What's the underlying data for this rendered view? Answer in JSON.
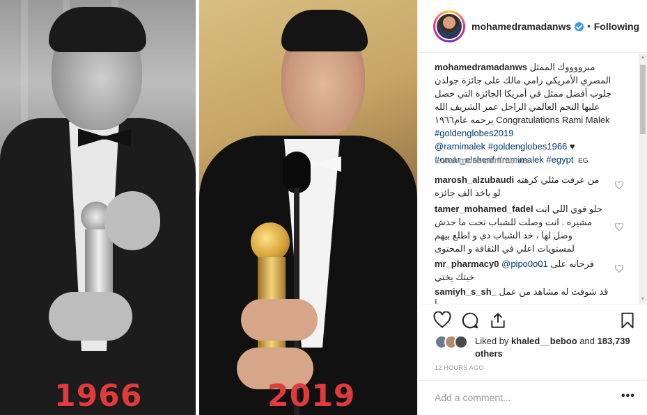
{
  "post_image": {
    "left_year": "1966",
    "right_year": "2019"
  },
  "header": {
    "username": "mohamedramadanws",
    "separator": "•",
    "follow_status": "Following"
  },
  "caption": {
    "username": "mohamedramadanws",
    "text_ar": "مبرووووك الممثل المصري الأمريكي رامي مالك على جائزة جولدن جلوب أفضل ممثل في أمريكا الجائزة التي حصل عليها النجم العالمي الراحل عمر الشريف الله يرحمه عام١٩٦٦",
    "text_en": "Congratulations Rami Malek",
    "tags_line1": "#goldenglobes2019",
    "mention": "@ramimalek",
    "tag_1966": "#goldenglobes1966",
    "heart": "♥",
    "tags_line3": "#omar_elsherif #ramimalek #egypt",
    "location_tag": "EG"
  },
  "load_more": "Load more comments",
  "comments": [
    {
      "username": "marosh_alzubaudi",
      "text": "من عرفت مثلي كرهته لو ياخذ الف جائزه"
    },
    {
      "username": "tamer_mohamed_fadel",
      "text": "حلو قوي اللي انت مشيره . انت وصلت للشباب تحت ما حدش وصل لها ، خد الشباب دي و اطلع بيهم لمستويات اعلي في الثقافة و المحتوى"
    },
    {
      "username": "mr_pharmacy0",
      "mention": "@pipo0o01",
      "text": "فرحانه على خبتك يختي"
    },
    {
      "username": "samiyh_s_sh_",
      "text": "قد شوفت له مشاهد من عمل من أ"
    }
  ],
  "likes": {
    "prefix": "Liked by",
    "user": "khaled__beboo",
    "and": "and",
    "count": "183,739 others"
  },
  "timestamp": "12 HOURS AGO",
  "add_comment": {
    "placeholder": "Add a comment..."
  },
  "more_options": "•••",
  "colors": {
    "link": "#003569",
    "year_red": "#e03a3a",
    "muted": "#999999",
    "border": "#efefef",
    "verified": "#3897f0"
  }
}
